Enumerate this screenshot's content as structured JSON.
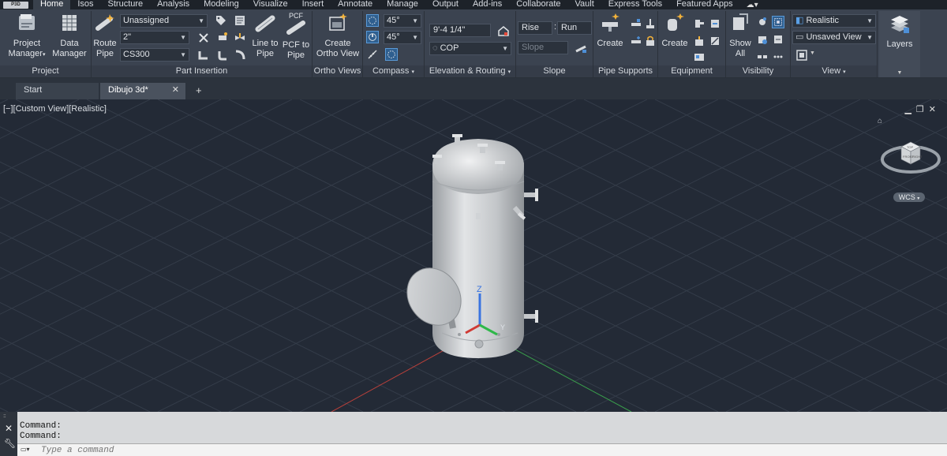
{
  "app": {
    "badge": "P3D"
  },
  "menu_tabs": [
    "Home",
    "Isos",
    "Structure",
    "Analysis",
    "Modeling",
    "Visualize",
    "Insert",
    "Annotate",
    "Manage",
    "Output",
    "Add-ins",
    "Collaborate",
    "Vault",
    "Express Tools",
    "Featured Apps"
  ],
  "ribbon": {
    "project": {
      "label": "Project",
      "project_manager": "Project Manager",
      "data_manager": "Data Manager"
    },
    "part_insertion": {
      "label": "Part Insertion",
      "route_pipe": "Route Pipe",
      "spec_value": "Unassigned",
      "size_value": "2\"",
      "material_value": "CS300",
      "line_to_pipe": "Line to Pipe",
      "pcf_to_pipe": "PCF to Pipe",
      "pcf_badge": "PCF"
    },
    "ortho_views": {
      "label": "Ortho Views",
      "create_ortho_view": "Create Ortho View"
    },
    "compass": {
      "label": "Compass",
      "angle1": "45°",
      "angle2": "45°"
    },
    "elevation": {
      "label": "Elevation & Routing",
      "elevation_value": "9'-4 1/4\"",
      "cop_value": "COP"
    },
    "slope": {
      "label": "Slope",
      "rise": "Rise",
      "run": "Run",
      "slope_placeholder": "Slope"
    },
    "pipe_supports": {
      "label": "Pipe Supports",
      "create": "Create"
    },
    "equipment": {
      "label": "Equipment",
      "create": "Create"
    },
    "visibility": {
      "label": "Visibility",
      "show_all": "Show All"
    },
    "view": {
      "label": "View",
      "visual_style": "Realistic",
      "saved_view": "Unsaved View"
    },
    "layers": {
      "label": "Layers"
    }
  },
  "file_tabs": {
    "start": "Start",
    "drawing": "Dibujo 3d*",
    "add": "+"
  },
  "viewport": {
    "label": "[−][Custom View][Realistic]",
    "wcs": "WCS",
    "axis_z": "Z",
    "axis_y": "Y",
    "viewcube_labels": {
      "top": "TOP",
      "front": "FRONT",
      "right": "RIGHT"
    }
  },
  "command": {
    "history": [
      "Command:",
      "Command:"
    ],
    "placeholder": "Type a command"
  },
  "colors": {
    "accent_blue": "#3d8ee0",
    "axis_x": "#d03a34",
    "axis_y": "#2fb84a",
    "axis_z": "#3a74e0",
    "vessel": "#c8cbcd"
  }
}
